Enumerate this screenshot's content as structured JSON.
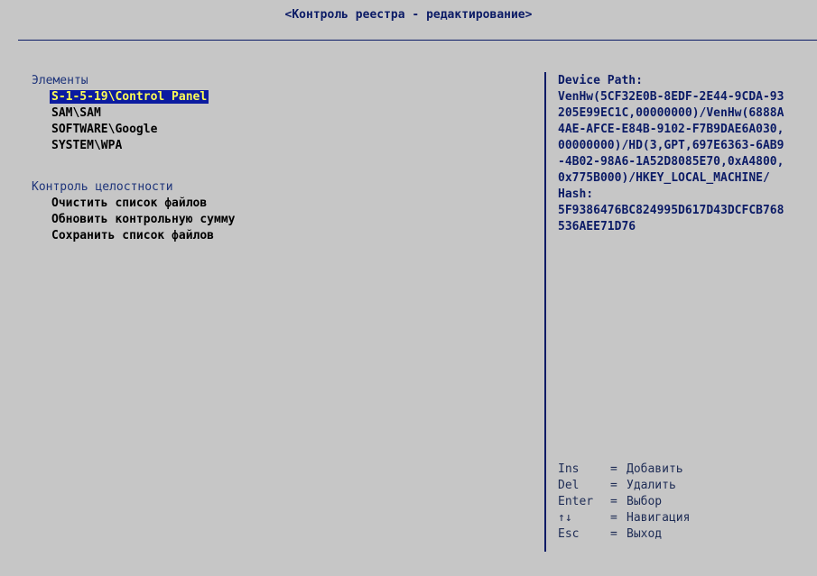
{
  "window": {
    "title": "<Контроль реестра - редактирование>"
  },
  "elements": {
    "header": "Элементы",
    "items": [
      {
        "label": "S-1-5-19\\Control Panel",
        "selected": true
      },
      {
        "label": "SAM\\SAM",
        "selected": false
      },
      {
        "label": "SOFTWARE\\Google",
        "selected": false
      },
      {
        "label": "SYSTEM\\WPA",
        "selected": false
      }
    ]
  },
  "integrity": {
    "header": "Контроль целостности",
    "items": [
      {
        "label": "Очистить список файлов"
      },
      {
        "label": "Обновить контрольную сумму"
      },
      {
        "label": "Сохранить список файлов"
      }
    ]
  },
  "details": {
    "lines": [
      "Device Path:",
      "VenHw(5CF32E0B-8EDF-2E44-9CDA-93",
      "205E99EC1C,00000000)/VenHw(6888A",
      "4AE-AFCE-E84B-9102-F7B9DAE6A030,",
      "00000000)/HD(3,GPT,697E6363-6AB9",
      "-4B02-98A6-1A52D8085E70,0xA4800,",
      "0x775B000)/HKEY_LOCAL_MACHINE/",
      "Hash:",
      "5F9386476BC824995D617D43DCFCB768",
      "536AEE71D76"
    ]
  },
  "help": {
    "rows": [
      {
        "key": "Ins",
        "eq": "=",
        "action": "Добавить"
      },
      {
        "key": "Del",
        "eq": "=",
        "action": "Удалить"
      },
      {
        "key": "Enter",
        "eq": "=",
        "action": "Выбор"
      },
      {
        "key": "↑↓",
        "eq": "=",
        "action": "Навигация"
      },
      {
        "key": "Esc",
        "eq": "=",
        "action": "Выход"
      }
    ]
  },
  "colors": {
    "background": "#c6c6c6",
    "selection_bg": "#0b1ba0",
    "selection_fg": "#ffff55",
    "text_dark_blue": "#0b1b66"
  }
}
